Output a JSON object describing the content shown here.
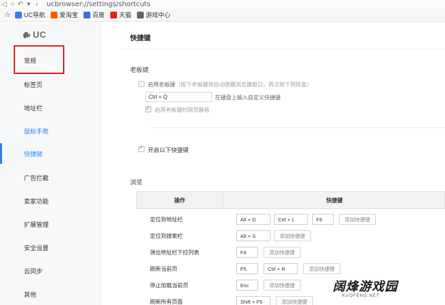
{
  "browser": {
    "url": "ucbrowser://settings/shortcuts"
  },
  "bookmarks": [
    {
      "label": "UC导航",
      "color": "#2f80ed"
    },
    {
      "label": "爱淘宝",
      "color": "#ff5a00"
    },
    {
      "label": "百度",
      "color": "#3a6fd8"
    },
    {
      "label": "天猫",
      "color": "#e1251b"
    },
    {
      "label": "游戏中心",
      "color": "#666666"
    }
  ],
  "sidebar": {
    "logo_text": "UC",
    "items": [
      {
        "label": "常规"
      },
      {
        "label": "标签页"
      },
      {
        "label": "地址栏"
      },
      {
        "label": "鼠标手势"
      },
      {
        "label": "快捷键"
      },
      {
        "label": "广告拦截"
      },
      {
        "label": "卖家功能"
      },
      {
        "label": "扩展管理"
      },
      {
        "label": "安全设置"
      },
      {
        "label": "云同步"
      },
      {
        "label": "其他"
      }
    ]
  },
  "main": {
    "title": "快捷键",
    "boss_key": {
      "section_label": "老板键",
      "enable_label": "启用老板键",
      "enable_hint": "（按下老板键将自动隐藏浏览器窗口，再次按下则恢复）",
      "shortcut_value": "Ctrl + Q",
      "shortcut_hint": "在键盘上输入自定义快捷键",
      "mute_label": "启用老板键时网页静音"
    },
    "enable_shortcuts_label": "开启以下快捷键",
    "browse": {
      "section_label": "浏览",
      "columns": [
        "操作",
        "快捷键"
      ],
      "add_label": "添加快捷键",
      "rows": [
        {
          "action": "定位到地址栏",
          "keys": [
            "Alt + D",
            "Ctrl + L",
            "F6"
          ]
        },
        {
          "action": "定位到搜索栏",
          "keys": [
            "Alt + S"
          ]
        },
        {
          "action": "弹出地址栏下拉列表",
          "keys": [
            "F4"
          ]
        },
        {
          "action": "刷新当前页",
          "keys": [
            "F5",
            "Ctrl + R"
          ]
        },
        {
          "action": "停止加载当前页",
          "keys": [
            "Esc"
          ]
        },
        {
          "action": "刷新所有页面",
          "keys": [
            "Shift + F5"
          ]
        }
      ]
    }
  },
  "watermark": {
    "text": "阔烽游戏园",
    "sub": "KUOFENG.NET"
  }
}
